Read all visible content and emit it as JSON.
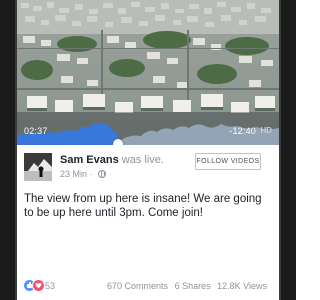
{
  "video": {
    "elapsed": "02:37",
    "remaining": "-12:40",
    "quality": "HD",
    "progress": 0.37
  },
  "post": {
    "author": "Sam Evans",
    "action": " was live.",
    "time_ago": "23 Min",
    "visibility_icon": "globe-icon",
    "follow_label": "FOLLOW VIDEOS",
    "text": "The view from up here is insane! We are going to be up here until 3pm. Come join!"
  },
  "footer": {
    "reaction_icons": [
      "like-icon",
      "love-icon"
    ],
    "reactions": "53",
    "comments": "670 Comments",
    "shares": "6 Shares",
    "views": "12.8K Views"
  },
  "colors": {
    "accent": "#5890ff",
    "love": "#f25268",
    "muted_text": "#90949c",
    "bezel": "#1b1b1b"
  }
}
